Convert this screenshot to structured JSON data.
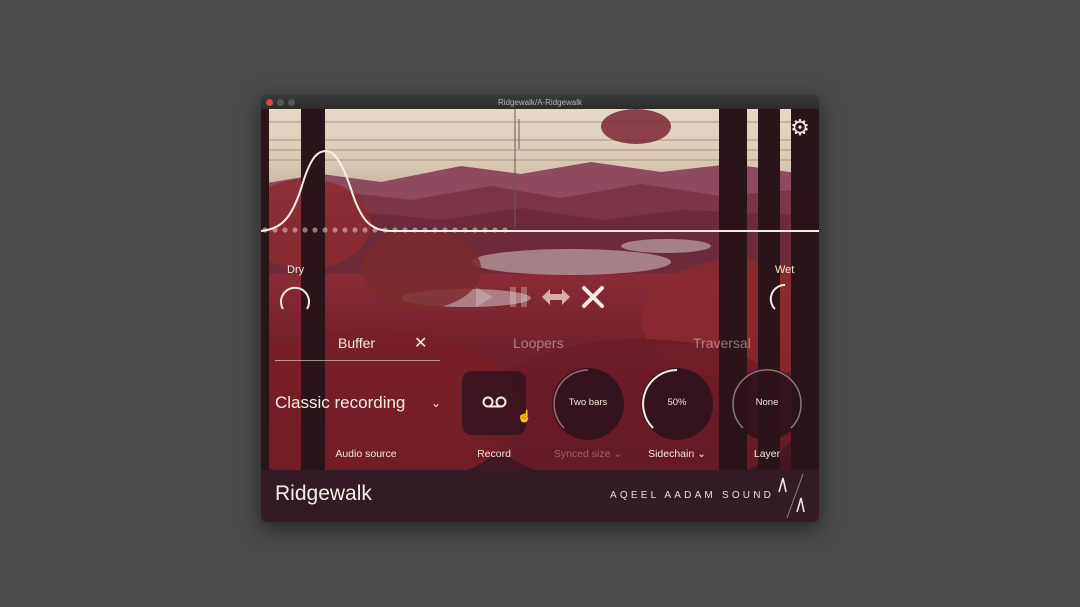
{
  "window": {
    "title": "Ridgewalk/A-Ridgewalk"
  },
  "header": {
    "settings_icon": "gear-icon"
  },
  "mix": {
    "dry_label": "Dry",
    "wet_label": "Wet"
  },
  "transport": {
    "play_icon": "play-icon",
    "pause_icon": "pause-icon",
    "swap_icon": "horizontal-arrows-icon",
    "clear_icon": "close-icon"
  },
  "tabs": [
    {
      "label": "Buffer",
      "active": true
    },
    {
      "label": "Loopers",
      "active": false
    },
    {
      "label": "Traversal",
      "active": false
    }
  ],
  "tab_close_glyph": "✕",
  "controls": {
    "audio_source": {
      "value": "Classic recording",
      "label": "Audio source",
      "chevron": "⌄"
    },
    "record": {
      "label": "Record",
      "icon": "voicemail-icon"
    },
    "synced_size": {
      "value": "Two bars",
      "label": "Synced size ⌄"
    },
    "sidechain": {
      "value": "50%",
      "label": "Sidechain ⌄"
    },
    "layer": {
      "value": "None",
      "label": "Layer"
    }
  },
  "footer": {
    "product_name": "Ridgewalk",
    "maker_name": "AQEEL AADAM SOUND",
    "logo": "aa-logo"
  },
  "colors": {
    "accent": "#f4ede5",
    "panel": "#341a24",
    "knob_bg": "#2d121c"
  }
}
